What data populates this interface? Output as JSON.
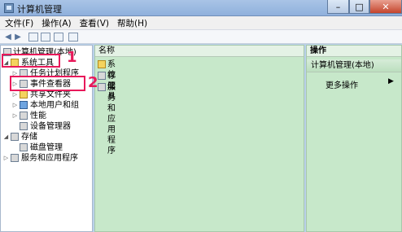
{
  "window": {
    "title": "计算机管理",
    "controls": {
      "minimize": "–",
      "maximize": "□",
      "close": "✕"
    }
  },
  "menu": [
    "文件(F)",
    "操作(A)",
    "查看(V)",
    "帮助(H)"
  ],
  "toolbar": {
    "icons": [
      "back-arrow-icon",
      "forward-arrow-icon",
      "up-folder-icon",
      "show-tree-icon",
      "properties-icon",
      "help-icon"
    ]
  },
  "tree": {
    "root": "计算机管理(本地)",
    "items": [
      {
        "label": "系统工具"
      },
      {
        "label": "任务计划程序"
      },
      {
        "label": "事件查看器"
      },
      {
        "label": "共享文件夹"
      },
      {
        "label": "本地用户和组"
      },
      {
        "label": "性能"
      },
      {
        "label": "设备管理器"
      },
      {
        "label": "存储"
      },
      {
        "label": "磁盘管理"
      },
      {
        "label": "服务和应用程序"
      }
    ]
  },
  "list": {
    "header": "名称",
    "rows": [
      "系统工具",
      "存储",
      "服务和应用程序"
    ]
  },
  "actions": {
    "header": "操作",
    "section": "计算机管理(本地)",
    "items": [
      "更多操作"
    ]
  },
  "annotations": {
    "num1": "1",
    "num2": "2",
    "color": "#e8195a"
  }
}
